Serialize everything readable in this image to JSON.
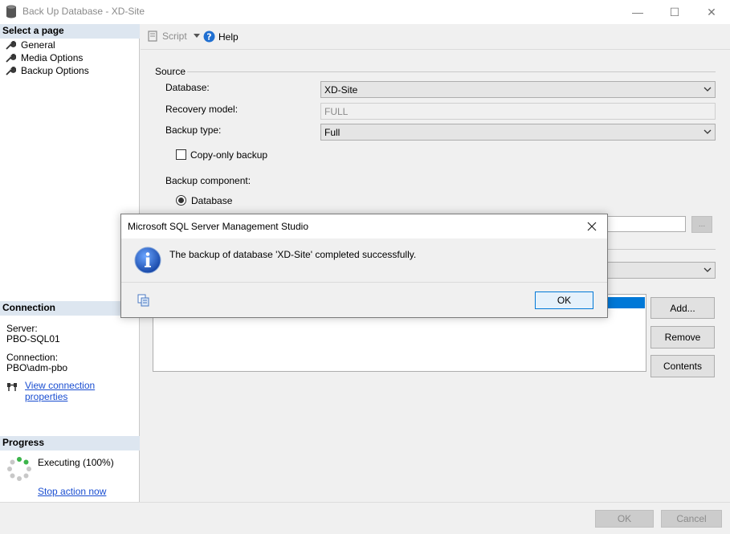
{
  "window": {
    "title": "Back Up Database - XD-Site",
    "minimize_glyph": "—",
    "maximize_glyph": "☐",
    "close_glyph": "✕"
  },
  "left_panel": {
    "select_page_header": "Select a page",
    "pages": [
      {
        "label": "General",
        "icon": "wrench-icon",
        "selected": true
      },
      {
        "label": "Media Options",
        "icon": "wrench-icon",
        "selected": false
      },
      {
        "label": "Backup Options",
        "icon": "wrench-icon",
        "selected": false
      }
    ],
    "connection_header": "Connection",
    "server_label": "Server:",
    "server_value": "PBO-SQL01",
    "connection_label": "Connection:",
    "connection_value": "PBO\\adm-pbo",
    "view_connection_link": "View connection properties",
    "progress_header": "Progress",
    "progress_status": "Executing (100%)",
    "stop_action_link": "Stop action now"
  },
  "toolbar": {
    "script_label": "Script",
    "help_label": "Help"
  },
  "source": {
    "section_label": "Source",
    "database_label": "Database:",
    "database_value": "XD-Site",
    "recovery_label": "Recovery model:",
    "recovery_value": "FULL",
    "backup_type_label": "Backup type:",
    "backup_type_value": "Full",
    "copy_only_label": "Copy-only backup",
    "copy_only_checked": false,
    "component_label": "Backup component:",
    "component_database_label": "Database",
    "browse_label": "..."
  },
  "destination": {
    "add_label": "Add...",
    "remove_label": "Remove",
    "contents_label": "Contents"
  },
  "footer": {
    "ok_label": "OK",
    "cancel_label": "Cancel"
  },
  "dialog": {
    "title": "Microsoft SQL Server Management Studio",
    "message": "The backup of database 'XD-Site' completed successfully.",
    "ok_label": "OK",
    "close_glyph": "✕"
  },
  "colors": {
    "accent_blue": "#0078d7",
    "info_icon_blue": "#1f5fbf",
    "link_blue": "#1a4ed1",
    "section_header_bg": "#dde6f0"
  }
}
